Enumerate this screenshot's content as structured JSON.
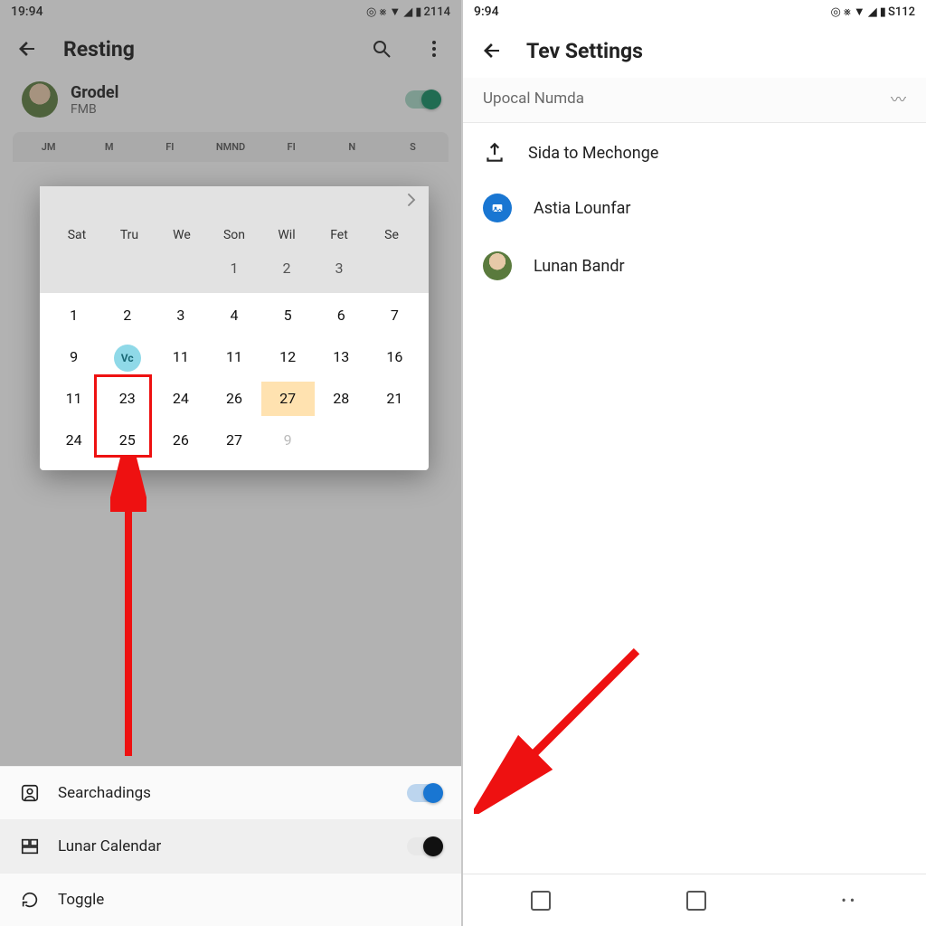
{
  "left": {
    "status_time": "19:94",
    "status_batt": "2114",
    "appbar": {
      "title": "Resting"
    },
    "profile": {
      "name": "Grodel",
      "sub": "FMB"
    },
    "week_strip": [
      "JM",
      "M",
      "FI",
      "NMND",
      "FI",
      "N",
      "S"
    ],
    "popup": {
      "dow": [
        "Sat",
        "Tru",
        "We",
        "Son",
        "Wil",
        "Fet",
        "Se"
      ],
      "rows": [
        [
          "",
          "",
          "",
          "1",
          "2",
          "3",
          ""
        ],
        [
          "1",
          "2",
          "3",
          "4",
          "5",
          "6",
          "7"
        ],
        [
          "9",
          "Vc",
          "11",
          "11",
          "12",
          "13",
          "16"
        ],
        [
          "11",
          "23",
          "24",
          "26",
          "27",
          "28",
          "21"
        ],
        [
          "24",
          "25",
          "26",
          "27",
          "9",
          "",
          ""
        ]
      ],
      "today_row": 2,
      "today_col": 1,
      "selected_row": 3,
      "selected_col": 4,
      "boxed_col": 1,
      "boxed_row_start": 3,
      "boxed_row_end": 4
    },
    "settings": [
      {
        "icon": "person-box",
        "label": "Searchadings",
        "toggle": "blue",
        "shade": false
      },
      {
        "icon": "layout",
        "label": "Lunar Calendar",
        "toggle": "black",
        "shade": true
      },
      {
        "icon": "refresh",
        "label": "Toggle",
        "toggle": "",
        "shade": false
      }
    ]
  },
  "right": {
    "status_time": "9:94",
    "status_batt": "S112",
    "appbar": {
      "title": "Tev Settings"
    },
    "subhead": "Upocal Numda",
    "items": [
      {
        "icon": "export",
        "label": "Sida to Mechonge"
      },
      {
        "icon": "photo-circle",
        "label": "Astia Lounfar"
      },
      {
        "icon": "avatar",
        "label": "Lunan Bandr"
      }
    ]
  },
  "icon_glyphs": {
    "target": "◎",
    "nosignal": "⨳",
    "wifi": "▼",
    "signal": "◢",
    "batt": "▮",
    "wave": "〰"
  }
}
